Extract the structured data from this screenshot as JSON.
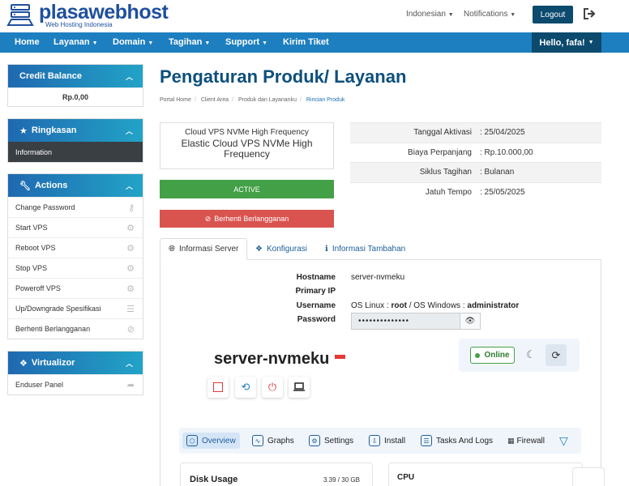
{
  "brand": {
    "name": "plasawebhost",
    "tagline": "Web Hosting Indonesia",
    "color": "#1f4f9e"
  },
  "header": {
    "language": "Indonesian",
    "notifications": "Notifications",
    "logout": "Logout"
  },
  "nav": {
    "items": [
      {
        "label": "Home"
      },
      {
        "label": "Layanan"
      },
      {
        "label": "Domain"
      },
      {
        "label": "Tagihan"
      },
      {
        "label": "Support"
      },
      {
        "label": "Kirim Tiket"
      }
    ],
    "greeting": "Hello, fafa!"
  },
  "sidebar": {
    "credit": {
      "title": "Credit Balance",
      "value": "Rp.0,00"
    },
    "ringkasan": {
      "title": "Ringkasan",
      "items": [
        {
          "label": "Information"
        }
      ]
    },
    "actions": {
      "title": "Actions",
      "items": [
        {
          "label": "Change Password"
        },
        {
          "label": "Start VPS"
        },
        {
          "label": "Reboot VPS"
        },
        {
          "label": "Stop VPS"
        },
        {
          "label": "Poweroff VPS"
        },
        {
          "label": "Up/Downgrade Spesifikasi"
        },
        {
          "label": "Berhenti Berlangganan"
        }
      ]
    },
    "virtualizor": {
      "title": "Virtualizor",
      "items": [
        {
          "label": "Enduser Panel"
        }
      ]
    }
  },
  "main": {
    "title": "Pengaturan Produk/ Layanan",
    "breadcrumbs": [
      "Portal Home",
      "Client Area",
      "Produk dan Layananku",
      "Rincian Produk"
    ],
    "product": {
      "group": "Cloud VPS NVMe High Frequency",
      "name": "Elastic Cloud VPS NVMe High Frequency",
      "status": "ACTIVE",
      "cancel_label": "Berhenti Berlangganan"
    },
    "info": [
      {
        "label": "Tanggal Aktivasi",
        "value": ": 25/04/2025"
      },
      {
        "label": "Biaya Perpanjang",
        "value": ": Rp.10.000,00"
      },
      {
        "label": "Siklus Tagihan",
        "value": ": Bulanan"
      },
      {
        "label": "Jatuh Tempo",
        "value": ": 25/05/2025"
      }
    ],
    "tabs": [
      {
        "label": "Informasi Server"
      },
      {
        "label": "Konfigurasi"
      },
      {
        "label": "Informasi Tambahan"
      }
    ],
    "server": {
      "hostname_label": "Hostname",
      "hostname": "server-nvmeku",
      "ip_label": "Primary IP",
      "username_label": "Username",
      "username_prefix": "OS Linux : ",
      "username_linux": "root",
      "username_mid": " / OS Windows : ",
      "username_windows": "administrator",
      "password_label": "Password",
      "password_mask": "••••••••••••••"
    },
    "vm": {
      "name": "server-nvmeku",
      "status": "Online",
      "tabs": [
        {
          "label": "Overview"
        },
        {
          "label": "Graphs"
        },
        {
          "label": "Settings"
        },
        {
          "label": "Install"
        },
        {
          "label": "Tasks And Logs"
        },
        {
          "label": "Firewall"
        }
      ],
      "disk": {
        "title": "Disk Usage",
        "value": "3.39 / 30 GB"
      },
      "cpu": {
        "title": "CPU"
      }
    }
  }
}
